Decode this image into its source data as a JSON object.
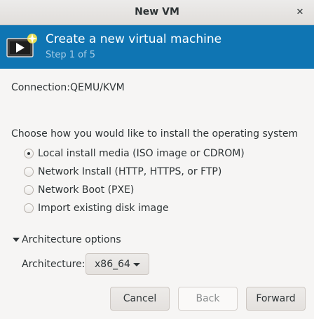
{
  "window": {
    "title": "New VM",
    "close_glyph": "✕"
  },
  "header": {
    "title": "Create a new virtual machine",
    "step": "Step 1 of 5",
    "icon": "vm-monitor-icon"
  },
  "connection": {
    "label": "Connection:",
    "value": "QEMU/KVM"
  },
  "install": {
    "prompt": "Choose how you would like to install the operating system",
    "options": [
      {
        "label": "Local install media (ISO image or CDROM)",
        "checked": true
      },
      {
        "label": "Network Install (HTTP, HTTPS, or FTP)",
        "checked": false
      },
      {
        "label": "Network Boot (PXE)",
        "checked": false
      },
      {
        "label": "Import existing disk image",
        "checked": false
      }
    ]
  },
  "architecture": {
    "expander_label": "Architecture options",
    "expanded": true,
    "label": "Architecture:",
    "value": "x86_64"
  },
  "buttons": {
    "cancel": "Cancel",
    "back": "Back",
    "forward": "Forward"
  },
  "colors": {
    "banner": "#0f75b3",
    "window_bg": "#f6f5f4",
    "text": "#2e3436"
  }
}
